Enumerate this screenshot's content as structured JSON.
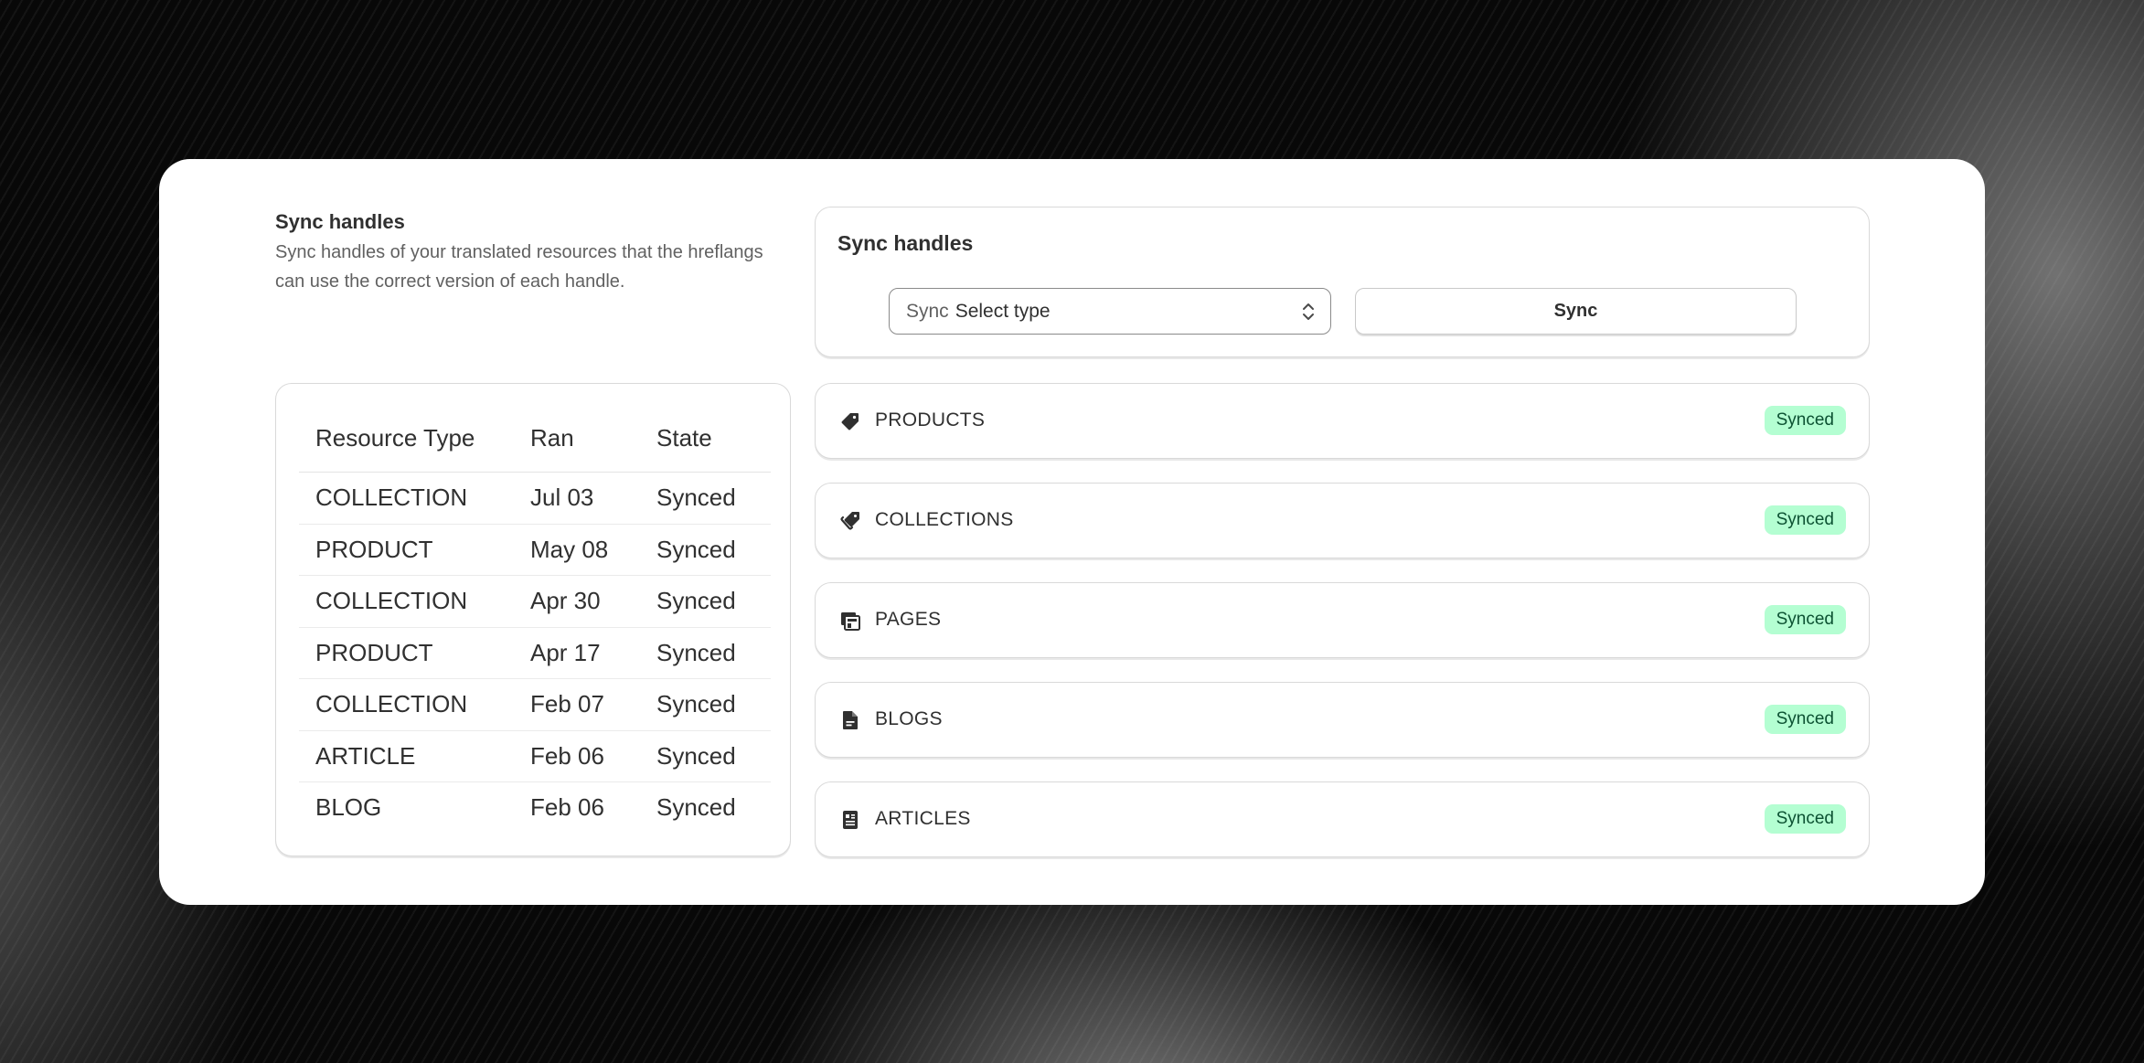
{
  "intro": {
    "title": "Sync handles",
    "description": "Sync handles of your translated resources that the hreflangs can use the correct version of each handle."
  },
  "sync_panel": {
    "title": "Sync handles",
    "select_prefix": "Sync",
    "select_value": "Select type",
    "button_label": "Sync"
  },
  "table": {
    "headers": [
      "Resource Type",
      "Ran",
      "State"
    ],
    "rows": [
      [
        "COLLECTION",
        "Jul 03",
        "Synced"
      ],
      [
        "PRODUCT",
        "May 08",
        "Synced"
      ],
      [
        "COLLECTION",
        "Apr 30",
        "Synced"
      ],
      [
        "PRODUCT",
        "Apr 17",
        "Synced"
      ],
      [
        "COLLECTION",
        "Feb 07",
        "Synced"
      ],
      [
        "ARTICLE",
        "Feb 06",
        "Synced"
      ],
      [
        "BLOG",
        "Feb 06",
        "Synced"
      ]
    ]
  },
  "resources": [
    {
      "label": "PRODUCTS",
      "icon": "product-tag-icon",
      "status": "Synced"
    },
    {
      "label": "COLLECTIONS",
      "icon": "collection-tags-icon",
      "status": "Synced"
    },
    {
      "label": "PAGES",
      "icon": "pages-icon",
      "status": "Synced"
    },
    {
      "label": "BLOGS",
      "icon": "blog-file-icon",
      "status": "Synced"
    },
    {
      "label": "ARTICLES",
      "icon": "article-icon",
      "status": "Synced"
    }
  ],
  "colors": {
    "badge_bg": "#b4fed2",
    "badge_text": "#0c5132",
    "text": "#303030"
  }
}
